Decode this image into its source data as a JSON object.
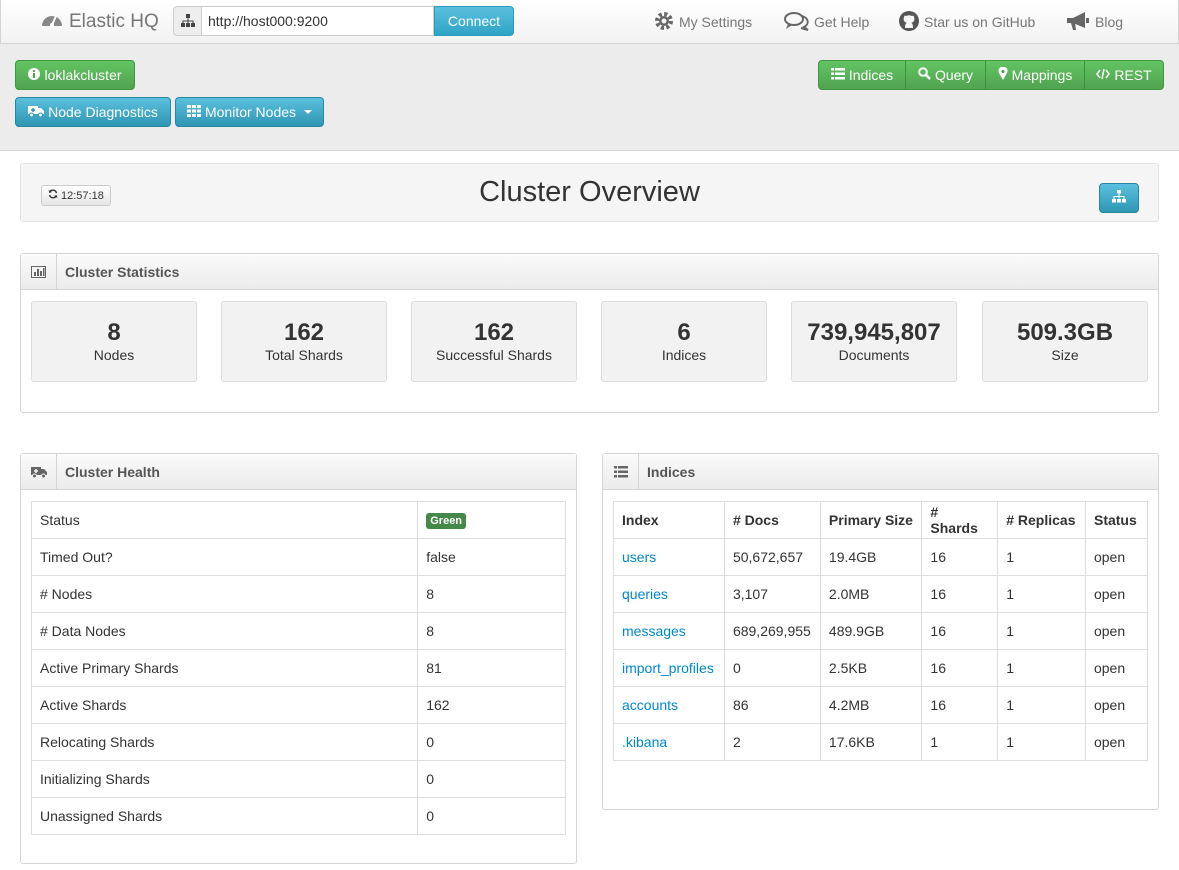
{
  "nav": {
    "brand": "Elastic HQ",
    "url_value": "http://host000:9200",
    "connect_label": "Connect",
    "links": [
      {
        "label": "My Settings",
        "icon": "gear-icon"
      },
      {
        "label": "Get Help",
        "icon": "comments-icon"
      },
      {
        "label": "Star us on GitHub",
        "icon": "github-icon"
      },
      {
        "label": "Blog",
        "icon": "bullhorn-icon"
      }
    ]
  },
  "toolbar": {
    "cluster_button": "loklakcluster",
    "node_diagnostics": "Node Diagnostics",
    "monitor_nodes": "Monitor Nodes",
    "indices": "Indices",
    "query": "Query",
    "mappings": "Mappings",
    "rest": "REST"
  },
  "overview": {
    "time": "12:57:18",
    "title": "Cluster Overview"
  },
  "stats": {
    "title": "Cluster Statistics",
    "items": [
      {
        "value": "8",
        "label": "Nodes"
      },
      {
        "value": "162",
        "label": "Total Shards"
      },
      {
        "value": "162",
        "label": "Successful Shards"
      },
      {
        "value": "6",
        "label": "Indices"
      },
      {
        "value": "739,945,807",
        "label": "Documents"
      },
      {
        "value": "509.3GB",
        "label": "Size"
      }
    ]
  },
  "health": {
    "title": "Cluster Health",
    "status_label": "Status",
    "status_value": "Green",
    "status_color": "#468847",
    "rows": [
      {
        "label": "Timed Out?",
        "value": "false"
      },
      {
        "label": "# Nodes",
        "value": "8"
      },
      {
        "label": "# Data Nodes",
        "value": "8"
      },
      {
        "label": "Active Primary Shards",
        "value": "81"
      },
      {
        "label": "Active Shards",
        "value": "162"
      },
      {
        "label": "Relocating Shards",
        "value": "0"
      },
      {
        "label": "Initializing Shards",
        "value": "0"
      },
      {
        "label": "Unassigned Shards",
        "value": "0"
      }
    ]
  },
  "indices": {
    "title": "Indices",
    "columns": [
      "Index",
      "# Docs",
      "Primary Size",
      "# Shards",
      "# Replicas",
      "Status"
    ],
    "rows": [
      [
        "users",
        "50,672,657",
        "19.4GB",
        "16",
        "1",
        "open"
      ],
      [
        "queries",
        "3,107",
        "2.0MB",
        "16",
        "1",
        "open"
      ],
      [
        "messages",
        "689,269,955",
        "489.9GB",
        "16",
        "1",
        "open"
      ],
      [
        "import_profiles",
        "0",
        "2.5KB",
        "16",
        "1",
        "open"
      ],
      [
        "accounts",
        "86",
        "4.2MB",
        "16",
        "1",
        "open"
      ],
      [
        ".kibana",
        "2",
        "17.6KB",
        "1",
        "1",
        "open"
      ]
    ]
  }
}
